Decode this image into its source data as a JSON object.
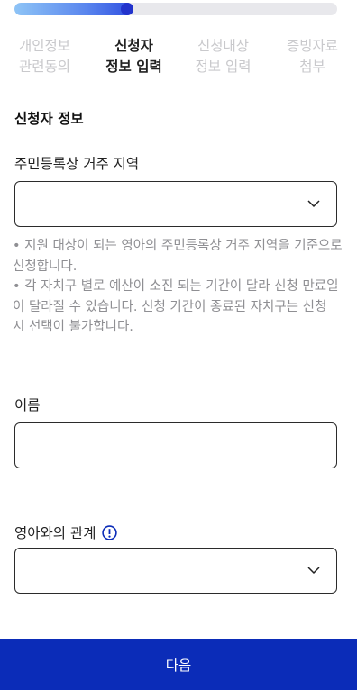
{
  "progress": {
    "value": 0.37
  },
  "steps": [
    {
      "line1": "개인정보",
      "line2": "관련동의",
      "active": false
    },
    {
      "line1": "신청자",
      "line2": "정보 입력",
      "active": true
    },
    {
      "line1": "신청대상",
      "line2": "정보 입력",
      "active": false
    },
    {
      "line1": "증빙자료",
      "line2": "첨부",
      "active": false
    }
  ],
  "applicant": {
    "section_title": "신청자 정보",
    "region_label": "주민등록상 거주 지역",
    "region_value": "",
    "notes": [
      "• 지원 대상이 되는 영아의 주민등록상 거주 지역을 기준으로 신청합니다.",
      "• 각 자치구 별로 예산이 소진 되는 기간이 달라 신청 만료일이 달라질 수 있습니다. 신청 기간이 종료된 자치구는 신청 시 선택이 불가합니다."
    ],
    "name_label": "이름",
    "name_value": "",
    "relation_label": "영아와의 관계",
    "relation_value": ""
  },
  "footer": {
    "next_label": "다음"
  },
  "colors": {
    "accent": "#0b2cb8",
    "progress_start": "#8ec4f6",
    "progress_end": "#2233cc",
    "muted": "#8f8f93"
  }
}
